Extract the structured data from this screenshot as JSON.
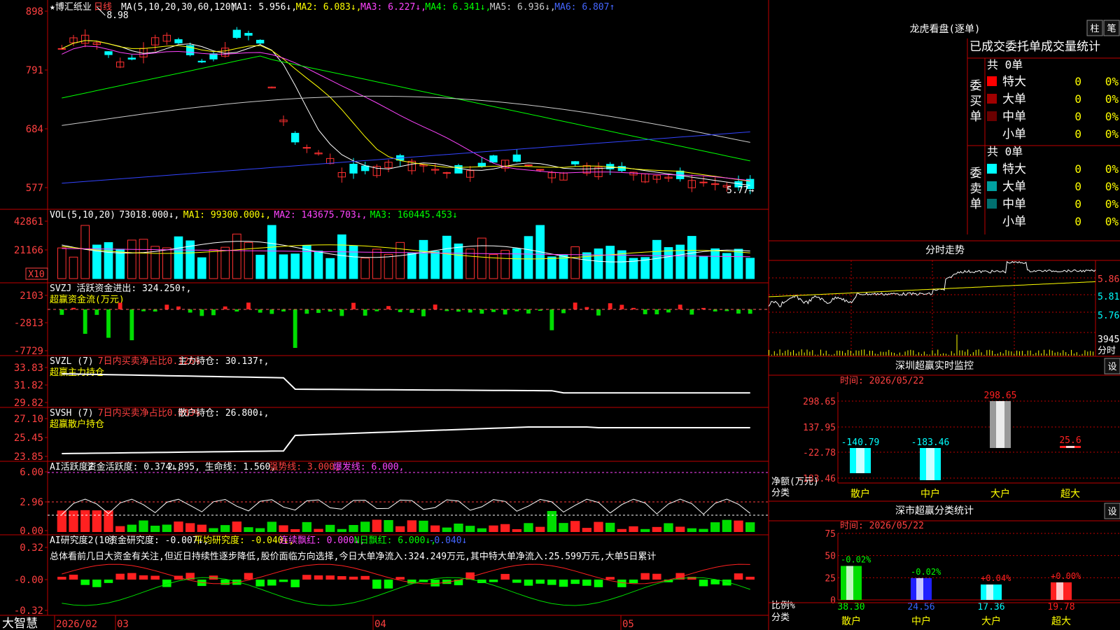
{
  "stock": {
    "name": "博汇纸业",
    "period": "日线",
    "star": "★"
  },
  "main_chart": {
    "ma_legend": [
      {
        "text": "MA(5,10,20,30,60,120)",
        "color": "#ffffff"
      },
      {
        "text": "MA1: 5.956↓,",
        "color": "#ffffff"
      },
      {
        "text": "MA2: 6.083↓,",
        "color": "#ffff00"
      },
      {
        "text": "MA3: 6.227↓,",
        "color": "#ff44ff"
      },
      {
        "text": "MA4: 6.341↓,",
        "color": "#00ff00"
      },
      {
        "text": "MA5: 6.936↓,",
        "color": "#cccccc"
      },
      {
        "text": "MA6: 6.807↑",
        "color": "#4466ff"
      }
    ],
    "y_ticks": [
      "898",
      "791",
      "684",
      "577"
    ],
    "high_label": "8.98",
    "low_label": "5.77→"
  },
  "vol_panel": {
    "legend": [
      {
        "text": "VOL(5,10,20)",
        "color": "#ffffff"
      },
      {
        "text": "73018.000↓,",
        "color": "#ffffff"
      },
      {
        "text": "MA1: 99300.000↓,",
        "color": "#ffff00"
      },
      {
        "text": "MA2: 143675.703↓,",
        "color": "#ff44ff"
      },
      {
        "text": "MA3: 160445.453↓",
        "color": "#00ff00"
      }
    ],
    "y_ticks": [
      "42861",
      "21166"
    ],
    "unit": "X10"
  },
  "svzj_panel": {
    "legend": [
      {
        "text": "SVZJ",
        "color": "#ffffff"
      },
      {
        "text": "活跃资金进出: 324.250↑,",
        "color": "#ffffff"
      }
    ],
    "subtitle": "超赢资金流(万元)",
    "y_ticks": [
      "2103",
      "-2813",
      "-7729"
    ]
  },
  "svzl_panel": {
    "legend": [
      {
        "text": "SVZL (7)",
        "color": "#ffffff"
      },
      {
        "text": "7日内买卖净占比0.126%",
        "color": "#ff4040"
      },
      {
        "text": "主力持仓: 30.137↑,",
        "color": "#ffffff"
      }
    ],
    "subtitle": "超赢主力持仓",
    "y_ticks": [
      "33.83",
      "31.82",
      "29.82"
    ]
  },
  "svsh_panel": {
    "legend": [
      {
        "text": "SVSH (7)",
        "color": "#ffffff"
      },
      {
        "text": "7日内买卖净占比0.083%",
        "color": "#ff4040"
      },
      {
        "text": "散户持仓: 26.800↓,",
        "color": "#ffffff"
      }
    ],
    "subtitle": "超赢散户持仓",
    "y_ticks": [
      "27.10",
      "25.45",
      "23.85"
    ]
  },
  "ai_active_panel": {
    "legend": [
      {
        "text": "AI活跃度2",
        "color": "#ffffff"
      },
      {
        "text": "资金活跃度: 0.374↓,",
        "color": "#ffffff"
      },
      {
        "text": "2.895,",
        "color": "#ffffff"
      },
      {
        "text": "生命线: 1.560,",
        "color": "#ffffff"
      },
      {
        "text": "强势线: 3.000,",
        "color": "#ff4040"
      },
      {
        "text": "爆发线: 6.000,",
        "color": "#ff44ff"
      }
    ],
    "y_ticks": [
      "6.00",
      "2.96",
      "0.00"
    ]
  },
  "ai_research_panel": {
    "legend": [
      {
        "text": "AI研究度2(10)",
        "color": "#ffffff"
      },
      {
        "text": "资金研究度: -0.007↓,",
        "color": "#ffffff"
      },
      {
        "text": "平均研究度: -0.040↓,",
        "color": "#ffff00"
      },
      {
        "text": "连续飘红: 0.000↓,",
        "color": "#ff44ff"
      },
      {
        "text": "N日飘红: 6.000↓,",
        "color": "#00ff00"
      },
      {
        "text": "-0.040↓",
        "color": "#4466ff"
      }
    ],
    "comment": "总体看前几日大资金有关注,但近日持续性逐步降低,股价面临方向选择,今日大单净流入:324.249万元,其中特大单净流入:25.599万元,大单5日累计",
    "y_ticks": [
      "0.32",
      "-0.00",
      "-0.32"
    ]
  },
  "bottom_axis": {
    "brand": "大智慧",
    "labels": [
      "2026/02",
      "03",
      "04",
      "05"
    ]
  },
  "right_panel": {
    "header_title": "龙虎看盘(逐单)",
    "btn_col": "柱",
    "btn_stroke": "笔",
    "order_title": "已成交委托单成交量统计",
    "buy_group_label": "委买单",
    "sell_group_label": "委卖单",
    "buy_total": "共 0单",
    "sell_total": "共 0单",
    "buy_rows": [
      {
        "name": "特大",
        "count": "0",
        "pct": "0%",
        "color": "#ff0000"
      },
      {
        "name": "大单",
        "count": "0",
        "pct": "0%",
        "color": "#a00000"
      },
      {
        "name": "中单",
        "count": "0",
        "pct": "0%",
        "color": "#6a0000"
      },
      {
        "name": "小单",
        "count": "0",
        "pct": "0%",
        "color": "#000000"
      }
    ],
    "sell_rows": [
      {
        "name": "特大",
        "count": "0",
        "pct": "0%",
        "color": "#00ffff"
      },
      {
        "name": "大单",
        "count": "0",
        "pct": "0%",
        "color": "#00a0a0"
      },
      {
        "name": "中单",
        "count": "0",
        "pct": "0%",
        "color": "#007070"
      },
      {
        "name": "小单",
        "count": "0",
        "pct": "0%",
        "color": "#000000"
      }
    ],
    "intraday_title": "分时走势",
    "intraday_prices": [
      "5.86",
      "5.81",
      "5.76"
    ],
    "intraday_vol_label": "3945",
    "intraday_vol_unit": "分时",
    "monitor_title": "深圳超赢实时监控",
    "monitor_setting": "设",
    "monitor_time": "时间: 2026/05/22",
    "monitor_yaxis": [
      "298.65",
      "137.95",
      "-22.78",
      "-183.46"
    ],
    "monitor_axis_title_1": "净额(万元)",
    "monitor_axis_title_2": "分类",
    "classify_title": "深市超赢分类统计",
    "classify_setting": "设",
    "classify_time": "时间: 2026/05/22",
    "classify_yaxis": [
      "75",
      "50",
      "25",
      "0"
    ],
    "classify_axis_title_1": "比例%",
    "classify_axis_title_2": "分类"
  },
  "chart_data": [
    {
      "type": "bar",
      "title": "深圳超赢实时监控",
      "categories": [
        "散户",
        "中户",
        "大户",
        "超大"
      ],
      "values": [
        -140.79,
        -183.46,
        298.65,
        25.6
      ],
      "value_labels": [
        "-140.79",
        "-183.46",
        "298.65",
        "25.6"
      ],
      "ylim": [
        -183.46,
        298.65
      ],
      "ylabel": "净额(万元)"
    },
    {
      "type": "bar",
      "title": "深市超赢分类统计",
      "categories": [
        "散户",
        "中户",
        "大户",
        "超大"
      ],
      "values": [
        38.3,
        24.56,
        17.36,
        19.78
      ],
      "value_labels": [
        "38.30",
        "24.56",
        "17.36",
        "19.78"
      ],
      "change_labels": [
        "-0.02%",
        "-0.02%",
        "+0.04%",
        "+0.00%"
      ],
      "ylim": [
        0,
        75
      ],
      "ylabel": "比例%"
    }
  ]
}
